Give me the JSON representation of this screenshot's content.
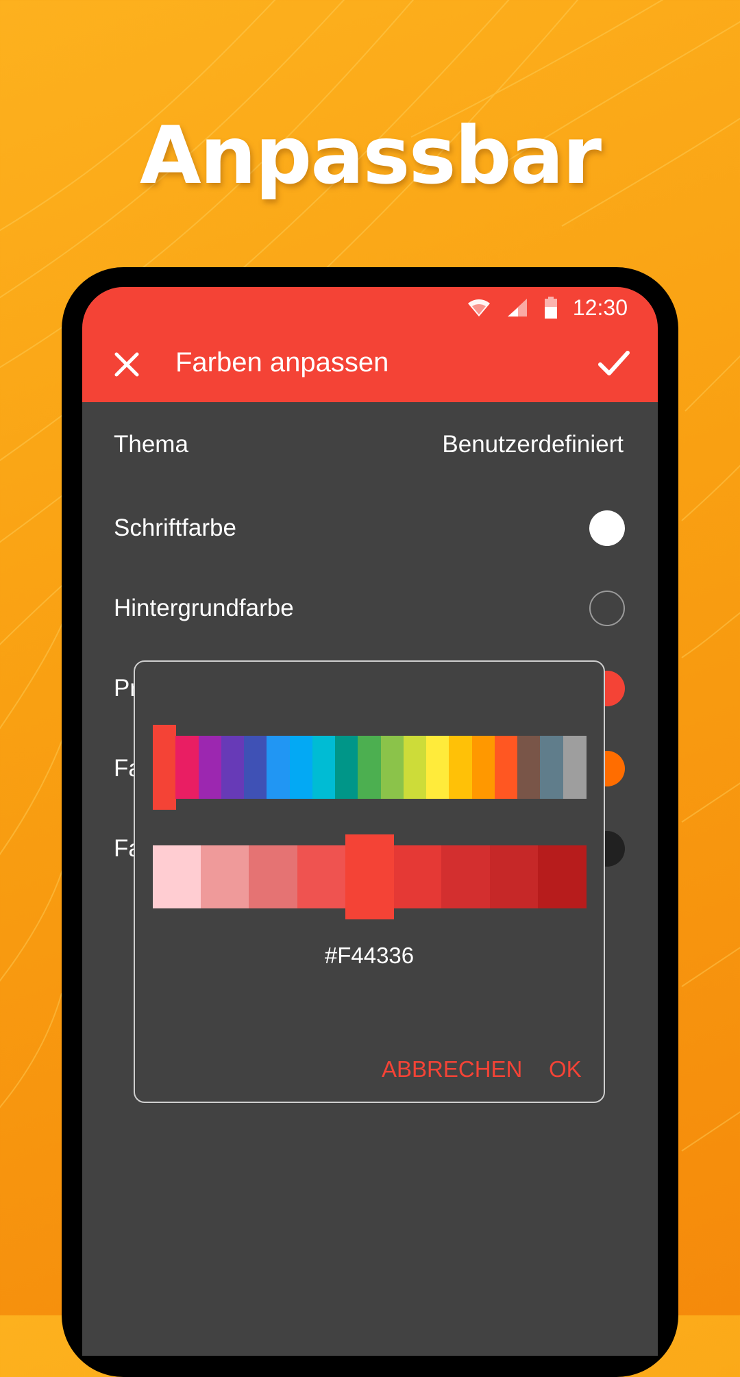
{
  "headline": "Anpassbar",
  "status_bar": {
    "time": "12:30",
    "icons": [
      "wifi-icon",
      "signal-icon",
      "battery-icon"
    ]
  },
  "app_bar": {
    "title": "Farben anpassen",
    "close_icon": "close-icon",
    "confirm_icon": "check-icon"
  },
  "settings": {
    "theme": {
      "label": "Thema",
      "value": "Benutzerdefiniert"
    },
    "rows": [
      {
        "label": "Schriftfarbe",
        "color": "#FFFFFF"
      },
      {
        "label": "Hintergrundfarbe",
        "color": "#424242"
      },
      {
        "label": "Pr",
        "color": "#F44336"
      },
      {
        "label": "Fa",
        "color": "#FF6D00"
      },
      {
        "label": "Fa",
        "color": "#212121"
      }
    ]
  },
  "color_dialog": {
    "hue_colors": [
      "#F44336",
      "#E91E63",
      "#9C27B0",
      "#673AB7",
      "#3F51B5",
      "#2196F3",
      "#03A9F4",
      "#00BCD4",
      "#009688",
      "#4CAF50",
      "#8BC34A",
      "#CDDC39",
      "#FFEB3B",
      "#FFC107",
      "#FF9800",
      "#FF5722",
      "#795548",
      "#607D8B",
      "#9E9E9E"
    ],
    "selected_hue": "#F44336",
    "shade_colors": [
      "#FFCDD2",
      "#EF9A9A",
      "#E57373",
      "#EF5350",
      "#F44336",
      "#E53935",
      "#D32F2F",
      "#C62828",
      "#B71C1C"
    ],
    "selected_shade": "#F44336",
    "hex_value": "#F44336",
    "cancel_label": "ABBRECHEN",
    "ok_label": "OK"
  },
  "colors": {
    "accent": "#F44336",
    "surface": "#424242",
    "background": "#F9A012"
  }
}
